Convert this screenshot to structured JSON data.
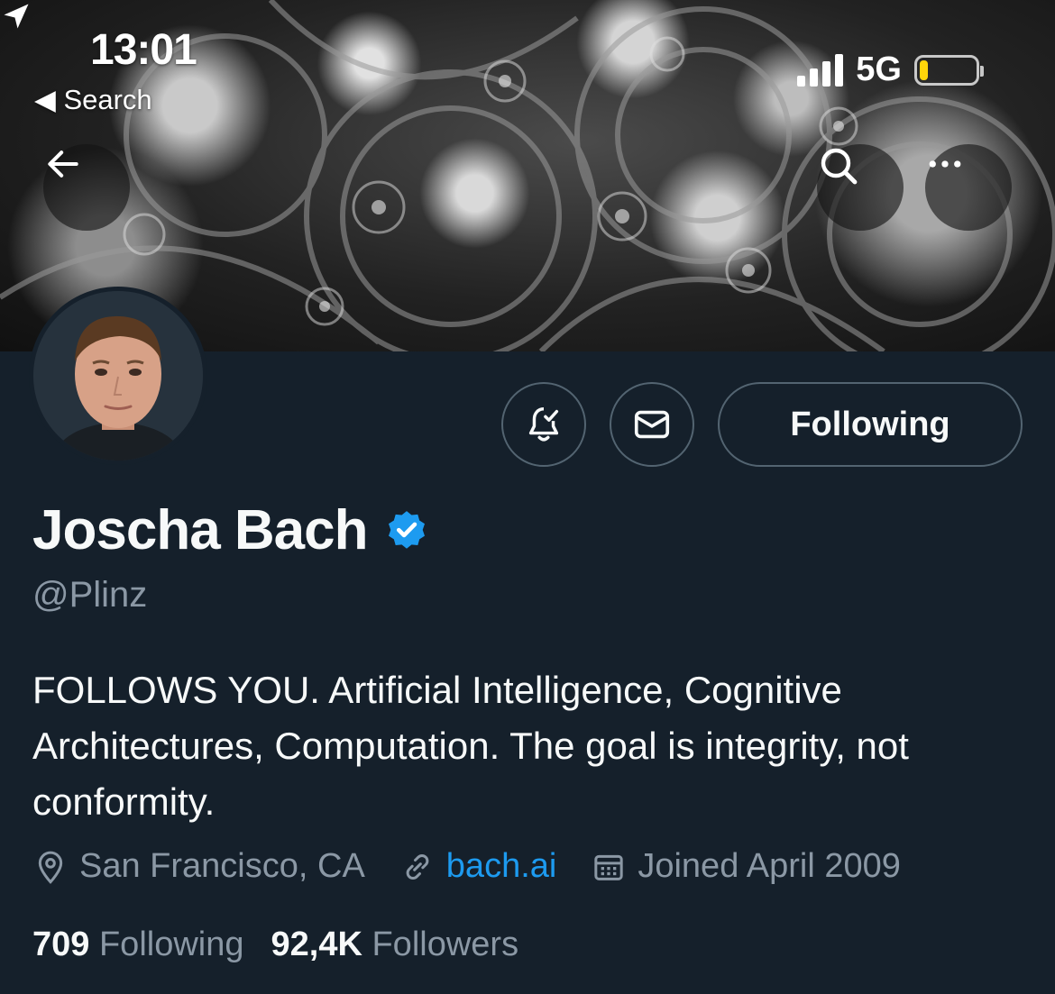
{
  "status_bar": {
    "time": "13:01",
    "back_label": "◀ Search",
    "network": "5G",
    "battery_level": 0.15
  },
  "header": {
    "back_icon": "arrow-left-icon",
    "search_icon": "search-icon",
    "more_icon": "more-icon"
  },
  "actions": {
    "notifications_icon": "bell-check-icon",
    "message_icon": "envelope-icon",
    "follow_label": "Following"
  },
  "profile": {
    "name": "Joscha Bach",
    "verified": true,
    "handle": "@Plinz",
    "bio": "FOLLOWS YOU. Artificial Intelligence, Cognitive Architectures, Computation. The goal is integrity, not conformity.",
    "location": "San Francisco, CA",
    "website": "bach.ai",
    "joined": "Joined April 2009"
  },
  "stats": {
    "following_count": "709",
    "following_label": "Following",
    "followers_count": "92,4K",
    "followers_label": "Followers"
  },
  "colors": {
    "background": "#15202b",
    "accent": "#1d9bf0",
    "secondary_text": "#8b98a5",
    "verified": "#1d9bf0"
  }
}
